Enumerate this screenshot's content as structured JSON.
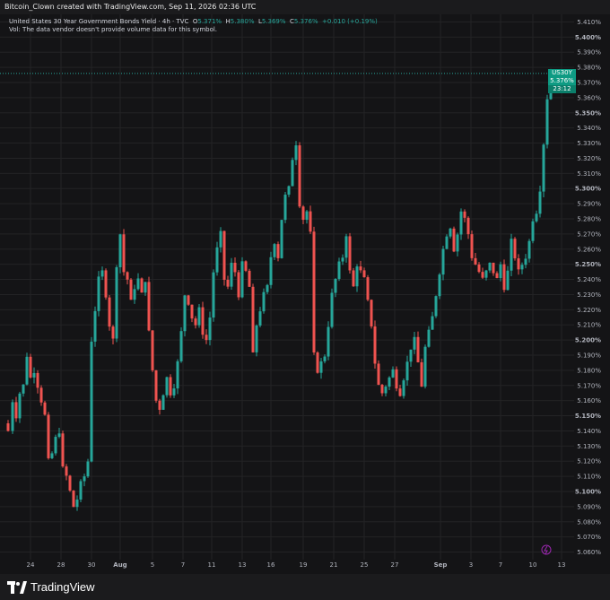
{
  "header": {
    "caption": "Bitcoin_Clown created with TradingView.com, Sep 11, 2026 02:36 UTC"
  },
  "legend": {
    "symbol_line": "United States 30 Year Government Bonds Yield · 4h · TVC",
    "o_label": "O",
    "o_value": "5.371%",
    "h_label": "H",
    "h_value": "5.380%",
    "l_label": "L",
    "l_value": "5.369%",
    "c_label": "C",
    "c_value": "5.376%",
    "change": "+0.010 (+0.19%)",
    "vol_line": "Vol: The data vendor doesn't provide volume data for this symbol."
  },
  "price_tag": {
    "symbol": "US30Y",
    "price": "5.376%",
    "countdown": "23:12"
  },
  "footer": {
    "brand": "TradingView"
  },
  "colors": {
    "up": "#26a69a",
    "down": "#ef5350",
    "background": "#141416",
    "grid": "#232325",
    "text": "#b2b5be",
    "tag": "#0e9b83"
  },
  "chart_data": {
    "type": "candlestick",
    "title": "United States 30 Year Government Bonds Yield · 4h · TVC",
    "ylim": [
      5.055,
      5.415
    ],
    "y_ticks": [
      "5.410%",
      "5.400%",
      "5.390%",
      "5.380%",
      "5.370%",
      "5.360%",
      "5.350%",
      "5.340%",
      "5.330%",
      "5.320%",
      "5.310%",
      "5.300%",
      "5.290%",
      "5.280%",
      "5.270%",
      "5.260%",
      "5.250%",
      "5.240%",
      "5.230%",
      "5.220%",
      "5.210%",
      "5.200%",
      "5.190%",
      "5.180%",
      "5.170%",
      "5.160%",
      "5.150%",
      "5.140%",
      "5.130%",
      "5.120%",
      "5.110%",
      "5.100%",
      "5.090%",
      "5.080%",
      "5.070%",
      "5.060%"
    ],
    "bold_ticks": [
      "5.400%",
      "5.350%",
      "5.300%",
      "5.250%",
      "5.200%",
      "5.150%",
      "5.100%"
    ],
    "x_ticks": [
      "24",
      "28",
      "30",
      "Aug",
      "5",
      "7",
      "11",
      "13",
      "16",
      "19",
      "21",
      "25",
      "27",
      "Sep",
      "3",
      "7",
      "10",
      "13"
    ],
    "bold_x_ticks": [
      "Aug",
      "Sep"
    ],
    "path": [
      [
        0,
        5.145
      ],
      [
        3,
        5.14
      ],
      [
        8,
        5.16
      ],
      [
        12,
        5.15
      ],
      [
        16,
        5.165
      ],
      [
        20,
        5.17
      ],
      [
        24,
        5.19
      ],
      [
        28,
        5.175
      ],
      [
        32,
        5.18
      ],
      [
        36,
        5.17
      ],
      [
        40,
        5.16
      ],
      [
        44,
        5.15
      ],
      [
        48,
        5.12
      ],
      [
        52,
        5.125
      ],
      [
        56,
        5.135
      ],
      [
        60,
        5.14
      ],
      [
        64,
        5.115
      ],
      [
        68,
        5.11
      ],
      [
        72,
        5.1
      ],
      [
        76,
        5.09
      ],
      [
        80,
        5.095
      ],
      [
        84,
        5.105
      ],
      [
        88,
        5.11
      ],
      [
        92,
        5.12
      ],
      [
        96,
        5.2
      ],
      [
        100,
        5.22
      ],
      [
        104,
        5.24
      ],
      [
        108,
        5.245
      ],
      [
        112,
        5.23
      ],
      [
        116,
        5.21
      ],
      [
        120,
        5.2
      ],
      [
        124,
        5.25
      ],
      [
        128,
        5.27
      ],
      [
        132,
        5.245
      ],
      [
        136,
        5.24
      ],
      [
        140,
        5.225
      ],
      [
        144,
        5.235
      ],
      [
        148,
        5.24
      ],
      [
        152,
        5.23
      ],
      [
        156,
        5.24
      ],
      [
        160,
        5.205
      ],
      [
        164,
        5.18
      ],
      [
        168,
        5.16
      ],
      [
        172,
        5.155
      ],
      [
        176,
        5.165
      ],
      [
        180,
        5.175
      ],
      [
        184,
        5.165
      ],
      [
        188,
        5.17
      ],
      [
        192,
        5.185
      ],
      [
        196,
        5.205
      ],
      [
        200,
        5.23
      ],
      [
        204,
        5.225
      ],
      [
        208,
        5.215
      ],
      [
        212,
        5.21
      ],
      [
        216,
        5.22
      ],
      [
        220,
        5.205
      ],
      [
        224,
        5.2
      ],
      [
        228,
        5.215
      ],
      [
        232,
        5.245
      ],
      [
        236,
        5.26
      ],
      [
        240,
        5.27
      ],
      [
        244,
        5.24
      ],
      [
        248,
        5.235
      ],
      [
        252,
        5.25
      ],
      [
        256,
        5.245
      ],
      [
        260,
        5.23
      ],
      [
        264,
        5.25
      ],
      [
        268,
        5.245
      ],
      [
        272,
        5.235
      ],
      [
        276,
        5.19
      ],
      [
        280,
        5.21
      ],
      [
        284,
        5.22
      ],
      [
        288,
        5.23
      ],
      [
        292,
        5.235
      ],
      [
        296,
        5.255
      ],
      [
        300,
        5.265
      ],
      [
        304,
        5.255
      ],
      [
        308,
        5.28
      ],
      [
        312,
        5.295
      ],
      [
        316,
        5.3
      ],
      [
        320,
        5.32
      ],
      [
        324,
        5.33
      ],
      [
        328,
        5.29
      ],
      [
        332,
        5.28
      ],
      [
        336,
        5.285
      ],
      [
        340,
        5.27
      ],
      [
        344,
        5.19
      ],
      [
        348,
        5.18
      ],
      [
        352,
        5.185
      ],
      [
        356,
        5.19
      ],
      [
        360,
        5.21
      ],
      [
        364,
        5.23
      ],
      [
        368,
        5.24
      ],
      [
        372,
        5.25
      ],
      [
        376,
        5.255
      ],
      [
        380,
        5.27
      ],
      [
        384,
        5.245
      ],
      [
        388,
        5.235
      ],
      [
        392,
        5.25
      ],
      [
        396,
        5.245
      ],
      [
        400,
        5.24
      ],
      [
        404,
        5.225
      ],
      [
        408,
        5.21
      ],
      [
        412,
        5.185
      ],
      [
        416,
        5.17
      ],
      [
        420,
        5.165
      ],
      [
        424,
        5.17
      ],
      [
        428,
        5.175
      ],
      [
        432,
        5.18
      ],
      [
        436,
        5.17
      ],
      [
        440,
        5.165
      ],
      [
        444,
        5.175
      ],
      [
        448,
        5.185
      ],
      [
        452,
        5.195
      ],
      [
        456,
        5.2
      ],
      [
        460,
        5.185
      ],
      [
        464,
        5.17
      ],
      [
        468,
        5.195
      ],
      [
        472,
        5.205
      ],
      [
        476,
        5.215
      ],
      [
        480,
        5.23
      ],
      [
        484,
        5.245
      ],
      [
        488,
        5.26
      ],
      [
        492,
        5.27
      ],
      [
        496,
        5.275
      ],
      [
        500,
        5.26
      ],
      [
        504,
        5.27
      ],
      [
        508,
        5.285
      ],
      [
        512,
        5.28
      ],
      [
        516,
        5.27
      ],
      [
        520,
        5.255
      ],
      [
        524,
        5.25
      ],
      [
        528,
        5.245
      ],
      [
        532,
        5.24
      ],
      [
        536,
        5.245
      ],
      [
        540,
        5.25
      ],
      [
        544,
        5.245
      ],
      [
        548,
        5.24
      ],
      [
        552,
        5.25
      ],
      [
        556,
        5.235
      ],
      [
        560,
        5.245
      ],
      [
        564,
        5.265
      ],
      [
        568,
        5.255
      ],
      [
        572,
        5.245
      ],
      [
        576,
        5.25
      ],
      [
        580,
        5.255
      ],
      [
        584,
        5.265
      ],
      [
        588,
        5.28
      ],
      [
        592,
        5.285
      ],
      [
        596,
        5.3
      ],
      [
        600,
        5.33
      ],
      [
        604,
        5.36
      ],
      [
        608,
        5.376
      ]
    ]
  }
}
